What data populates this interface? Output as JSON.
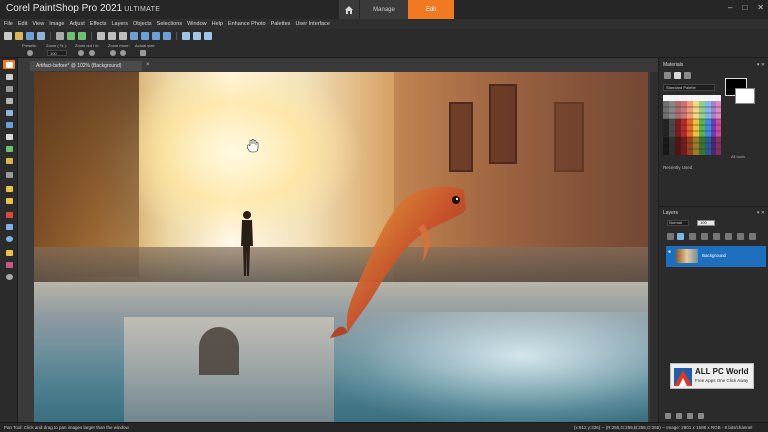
{
  "titlebar": {
    "brand": "Corel",
    "product": "PaintShop Pro 2021",
    "edition": "ULTIMATE",
    "tabs": {
      "manage": "Manage",
      "edit": "Edit"
    },
    "window_controls": {
      "minimize": "–",
      "maximize": "□",
      "close": "✕"
    }
  },
  "menu": [
    "File",
    "Edit",
    "View",
    "Image",
    "Adjust",
    "Effects",
    "Layers",
    "Objects",
    "Selections",
    "Window",
    "Help",
    "Enhance Photo",
    "Palettes",
    "User Interface"
  ],
  "tool_options": {
    "presets_label": "Presets:",
    "zoom_pct_label": "Zoom ( % ):",
    "zoom_value": "100",
    "zoom_inout_label": "Zoom out / in:",
    "zoom_more_label": "Zoom more:",
    "actual_size_label": "Actual size:"
  },
  "document": {
    "tab_title": "Artifact-before* @ 102% (Background)",
    "close": "×"
  },
  "materials": {
    "title": "Materials",
    "palette": "Standard Palette",
    "all_tools": "All tools",
    "recently_used": "Recently Used",
    "ctrls": "▾ ✕"
  },
  "layers": {
    "title": "Layers",
    "blend_mode": "Normal",
    "opacity": "100",
    "ctrls": "▾ ✕",
    "items": [
      {
        "name": "Background"
      }
    ]
  },
  "watermark": {
    "title": "ALL PC World",
    "subtitle": "Free Apps One Click Away"
  },
  "status": {
    "hint": "Pan Tool: Click and drag to pan images larger than the window.",
    "info": "(x:912 y:336) -- (R:255,G:255,B:255,O:255) -- Image: 2801 x 1598 x RGB - 8 bits/channel"
  },
  "colors": {
    "accent": "#f07922",
    "selection": "#1f6fbf"
  }
}
